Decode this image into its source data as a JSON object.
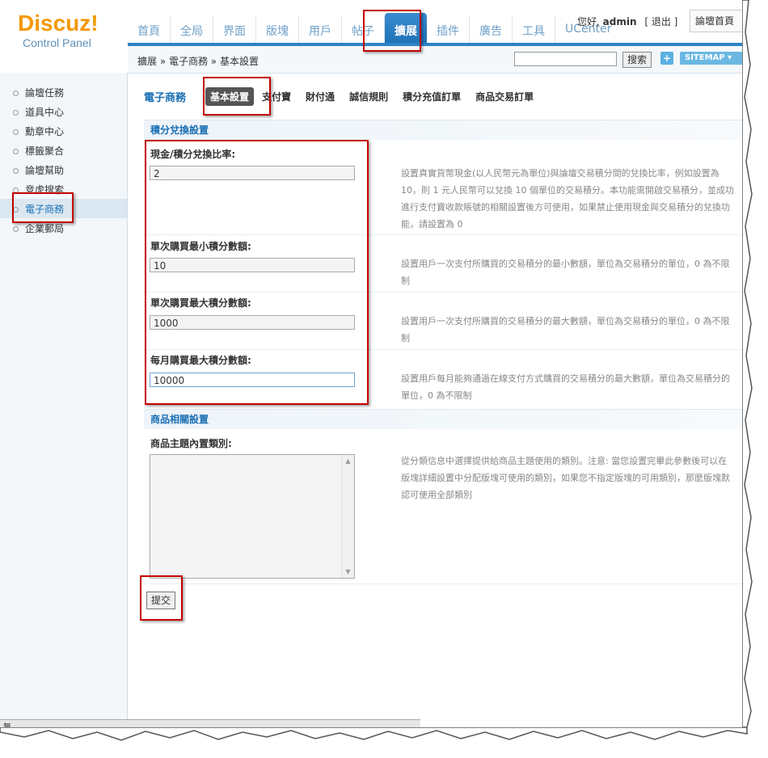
{
  "logo": {
    "main": "Discuz!",
    "sub": "Control Panel"
  },
  "topnav": [
    {
      "label": "首頁",
      "active": false
    },
    {
      "label": "全局",
      "active": false
    },
    {
      "label": "界面",
      "active": false
    },
    {
      "label": "版塊",
      "active": false
    },
    {
      "label": "用戶",
      "active": false
    },
    {
      "label": "帖子",
      "active": false
    },
    {
      "label": "擴展",
      "active": true
    },
    {
      "label": "插件",
      "active": false
    },
    {
      "label": "廣告",
      "active": false
    },
    {
      "label": "工具",
      "active": false
    },
    {
      "label": "UCenter",
      "active": false
    }
  ],
  "userbar": {
    "greeting": "您好,",
    "username": "admin",
    "logout": "[ 退出 ]"
  },
  "home_button": "論壇首頁",
  "breadcrumb": "擴展 » 電子商務 » 基本設置",
  "search": {
    "button": "搜索",
    "value": ""
  },
  "sitemap": "SITEMAP ▾",
  "plus": "+",
  "sidebar": [
    {
      "label": "論壇任務",
      "active": false
    },
    {
      "label": "道具中心",
      "active": false
    },
    {
      "label": "勳章中心",
      "active": false
    },
    {
      "label": "標籤聚合",
      "active": false
    },
    {
      "label": "論壇幫助",
      "active": false
    },
    {
      "label": "竞虎搜索",
      "active": false
    },
    {
      "label": "電子商務",
      "active": true
    },
    {
      "label": "企業郵局",
      "active": false
    }
  ],
  "subtabs": {
    "title": "電子商務",
    "items": [
      {
        "label": "基本設置",
        "active": true
      },
      {
        "label": "支付寶",
        "active": false
      },
      {
        "label": "財付通",
        "active": false
      },
      {
        "label": "誠信規則",
        "active": false
      },
      {
        "label": "積分充值訂單",
        "active": false
      },
      {
        "label": "商品交易訂單",
        "active": false
      }
    ]
  },
  "section1": "積分兌換設置",
  "fields": [
    {
      "label": "現金/積分兌換比率:",
      "value": "2",
      "desc": "設置真實貨幣現金(以人民幣元為單位)與論壇交易積分間的兌換比率，例如設置為 10，則 1 元人民幣可以兌換 10 個單位的交易積分。本功能需開啟交易積分，並成功進行支付寶收款賬號的相關設置後方可使用，如果禁止使用現金與交易積分的兌換功能，請設置為 0"
    },
    {
      "label": "單次購買最小積分數額:",
      "value": "10",
      "desc": "設置用戶一次支付所購買的交易積分的最小數額，單位為交易積分的單位，0 為不限制"
    },
    {
      "label": "單次購買最大積分數額:",
      "value": "1000",
      "desc": "設置用戶一次支付所購買的交易積分的最大數額，單位為交易積分的單位，0 為不限制"
    },
    {
      "label": "每月購買最大積分數額:",
      "value": "10000",
      "desc": "設置用戶每月能夠通過在線支付方式購買的交易積分的最大數額，單位為交易積分的單位，0 為不限制"
    }
  ],
  "section2": "商品相關設置",
  "goods": {
    "label": "商品主題內置類別:",
    "desc": "從分類信息中選擇提供給商品主題使用的類別。注意: 當您設置完畢此參數後可以在版塊詳細設置中分配版塊可使用的類別，如果您不指定版塊的可用類別，那麼版塊默認可使用全部類別"
  },
  "submit": "提交",
  "taskbar_char": "無"
}
